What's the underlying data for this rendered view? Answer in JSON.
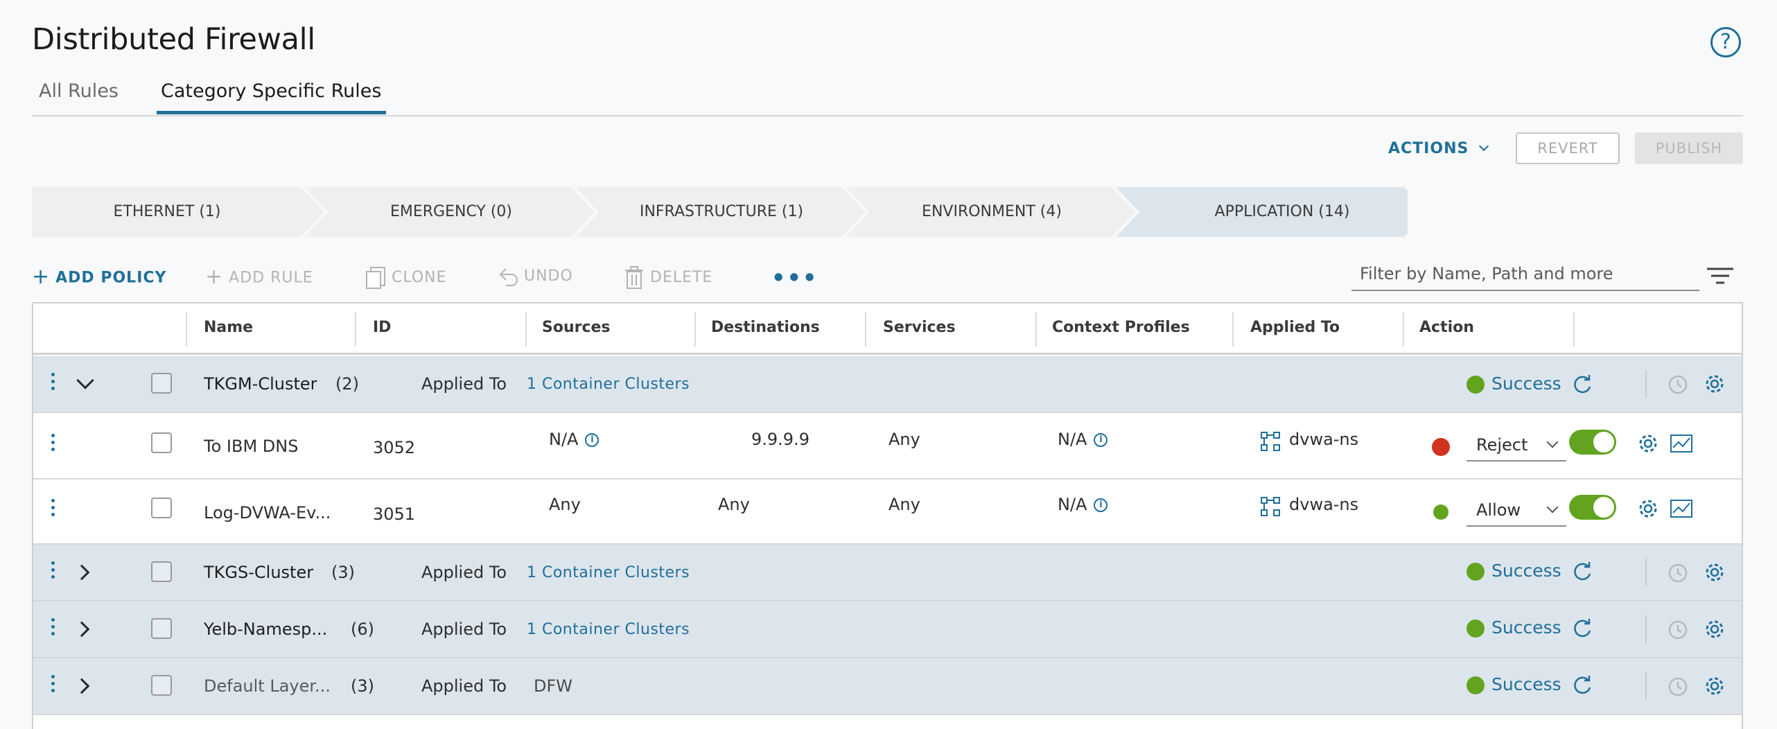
{
  "page": {
    "title": "Distributed Firewall",
    "tabs": [
      "All Rules",
      "Category Specific Rules"
    ]
  },
  "actions": {
    "actions_label": "ACTIONS",
    "revert_label": "REVERT",
    "publish_label": "PUBLISH"
  },
  "categories": [
    {
      "label": "ETHERNET (1)",
      "active": false
    },
    {
      "label": "EMERGENCY (0)",
      "active": false
    },
    {
      "label": "INFRASTRUCTURE (1)",
      "active": false
    },
    {
      "label": "ENVIRONMENT (4)",
      "active": false
    },
    {
      "label": "APPLICATION (14)",
      "active": true
    }
  ],
  "toolbar": {
    "add_policy": "ADD POLICY",
    "add_rule": "ADD RULE",
    "clone": "CLONE",
    "undo": "UNDO",
    "delete": "DELETE",
    "more": "•••",
    "filter_placeholder": "Filter by Name, Path and more"
  },
  "columns": [
    "Name",
    "ID",
    "Sources",
    "Destinations",
    "Services",
    "Context Profiles",
    "Applied To",
    "Action"
  ],
  "policies": [
    {
      "name": "TKGM-Cluster",
      "count": "(2)",
      "applied_label": "Applied To",
      "applied_value": "1 Container Clusters",
      "status": "Success",
      "expanded": true
    },
    {
      "name": "TKGS-Cluster",
      "count": "(3)",
      "applied_label": "Applied To",
      "applied_value": "1 Container Clusters",
      "status": "Success",
      "expanded": false
    },
    {
      "name": "Yelb-Namesp...",
      "count": "(6)",
      "applied_label": "Applied To",
      "applied_value": "1 Container Clusters",
      "status": "Success",
      "expanded": false
    },
    {
      "name": "Default Layer...",
      "count": "(3)",
      "applied_label": "Applied To",
      "applied_value": "DFW",
      "status": "Success",
      "expanded": false
    }
  ],
  "rules": [
    {
      "name": "To IBM DNS",
      "id": "3052",
      "sources": "N/A",
      "destinations": "9.9.9.9",
      "services": "Any",
      "context_profiles": "N/A",
      "applied_to": "dvwa-ns",
      "action": "Reject",
      "enabled": true
    },
    {
      "name": "Log-DVWA-Ev...",
      "id": "3051",
      "sources": "Any",
      "destinations": "Any",
      "services": "Any",
      "context_profiles": "N/A",
      "applied_to": "dvwa-ns",
      "action": "Allow",
      "enabled": true
    }
  ],
  "colors": {
    "accent": "#1f6f9a",
    "success": "#62a420",
    "reject": "#d0331e",
    "policy_row_bg": "#dde5ec"
  }
}
